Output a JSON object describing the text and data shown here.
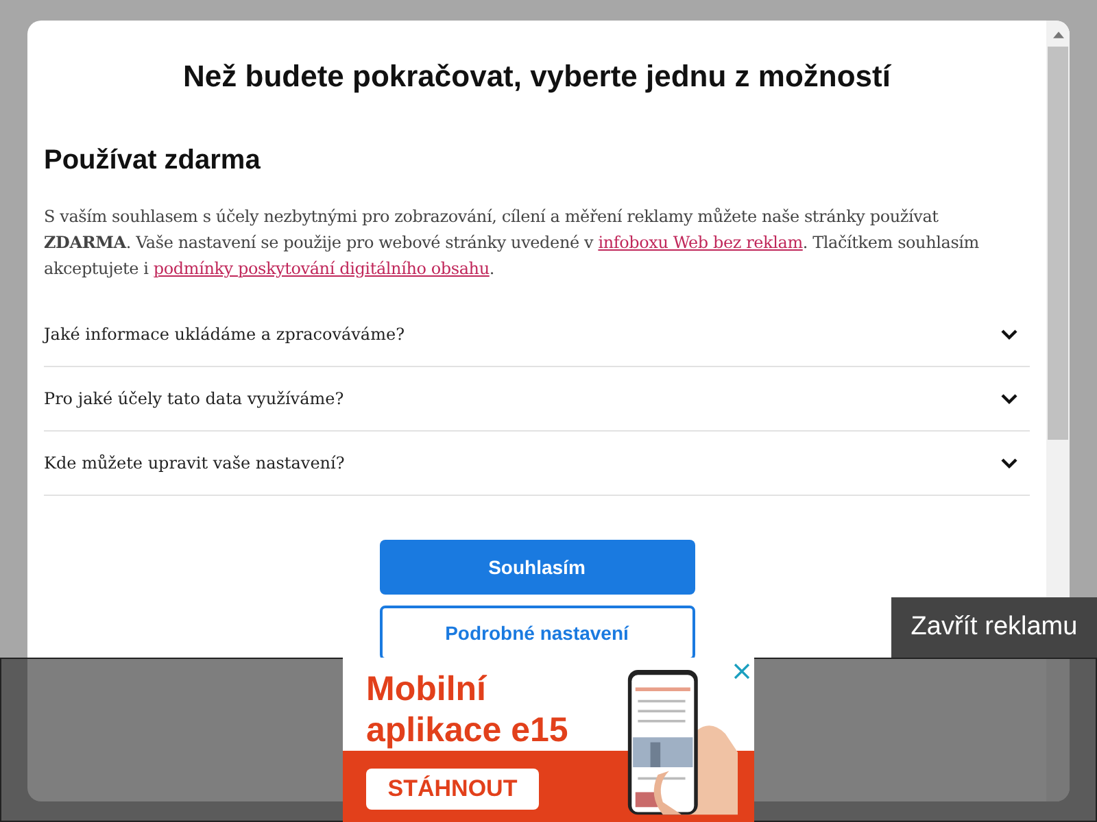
{
  "dialog": {
    "title": "Než budete pokračovat, vyberte jednu z možností",
    "section_title": "Používat zdarma",
    "intro": [
      {
        "kind": "text",
        "text": "S vaším souhlasem s účely nezbytnými pro zobrazování, cílení a měření reklamy můžete naše stránky používat **ZDARMA**. Vaše nastavení se použije pro webové stránky uvedené v "
      },
      {
        "kind": "link",
        "text": "infoboxu Web bez reklam"
      },
      {
        "kind": "text",
        "text": ". Tlačítkem souhlasím akceptujete i "
      },
      {
        "kind": "link",
        "text": "podmínky poskytování digitálního obsahu"
      },
      {
        "kind": "text",
        "text": "."
      }
    ],
    "accordion": [
      {
        "label": "Jaké informace ukládáme a zpracováváme?",
        "expanded": false
      },
      {
        "label": "Pro jaké účely tato data využíváme?",
        "expanded": false
      },
      {
        "label": "Kde můžete upravit vaše nastavení?",
        "expanded": false
      }
    ],
    "buttons": [
      {
        "label": "Souhlasím",
        "kind": "primary"
      },
      {
        "label": "Podrobné nastavení",
        "kind": "secondary"
      }
    ]
  },
  "ad": {
    "close_label": "Zavřít reklamu",
    "headline": "Mobilní aplikace e15",
    "cta": "STÁHNOUT"
  }
}
